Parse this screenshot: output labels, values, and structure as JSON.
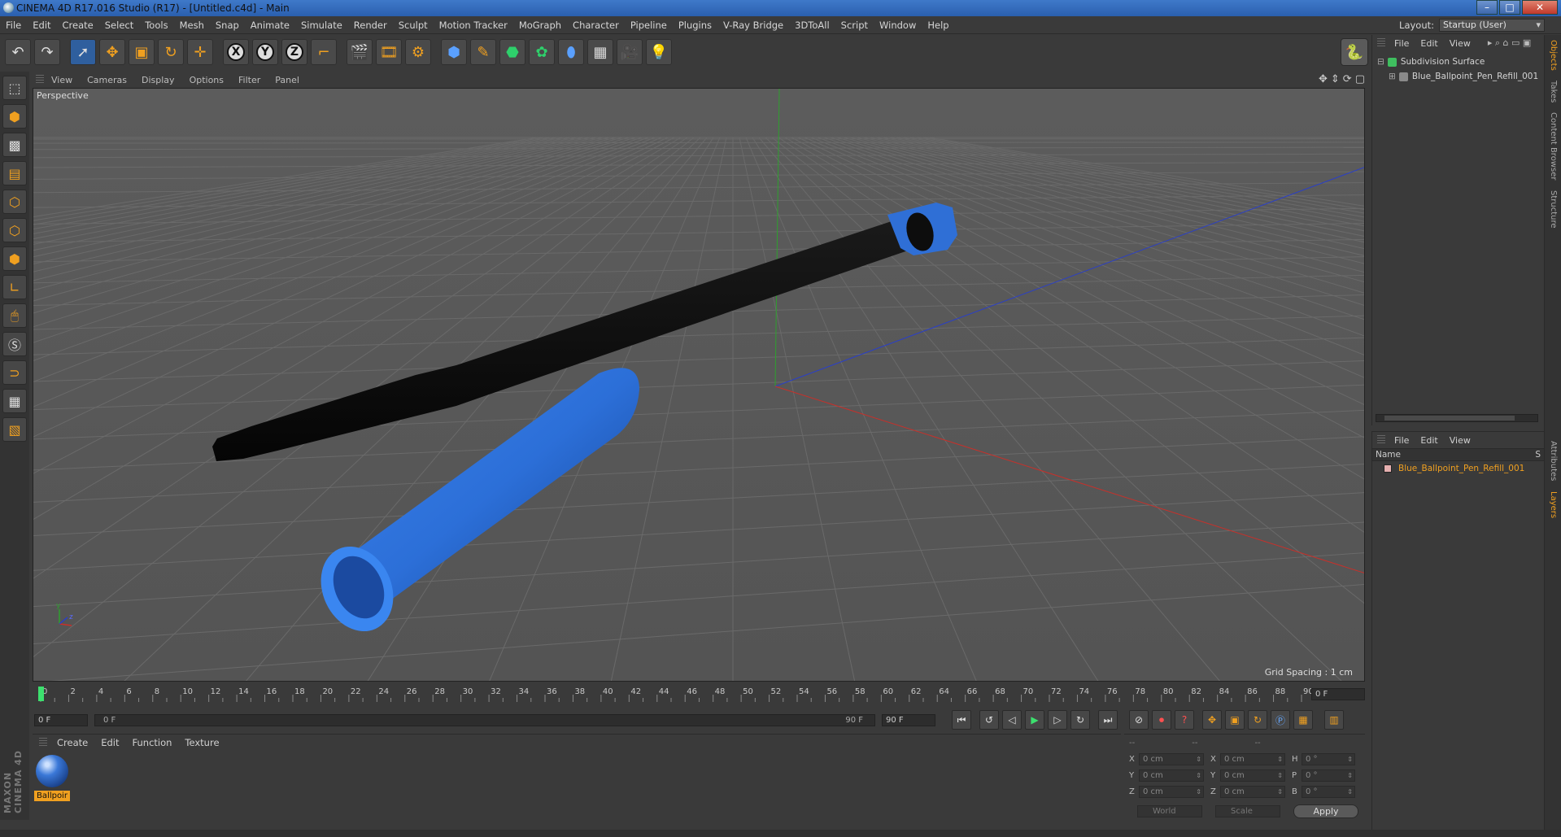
{
  "window": {
    "title": "CINEMA 4D R17.016 Studio (R17) - [Untitled.c4d] - Main",
    "min": "–",
    "max": "□",
    "close": "✕"
  },
  "menu": [
    "File",
    "Edit",
    "Create",
    "Select",
    "Tools",
    "Mesh",
    "Snap",
    "Animate",
    "Simulate",
    "Render",
    "Sculpt",
    "Motion Tracker",
    "MoGraph",
    "Character",
    "Pipeline",
    "Plugins",
    "V-Ray Bridge",
    "3DToAll",
    "Script",
    "Window",
    "Help"
  ],
  "layout": {
    "label": "Layout:",
    "value": "Startup (User)"
  },
  "toolbar": {
    "x_label": "X",
    "y_label": "Y",
    "z_label": "Z"
  },
  "viewport": {
    "menu": [
      "View",
      "Cameras",
      "Display",
      "Options",
      "Filter",
      "Panel"
    ],
    "camera": "Perspective",
    "grid_spacing": "Grid Spacing : 1 cm",
    "gizmo_y": "y",
    "gizmo_z": "z"
  },
  "timeline": {
    "ticks": [
      0,
      2,
      4,
      6,
      8,
      10,
      12,
      14,
      16,
      18,
      20,
      22,
      24,
      26,
      28,
      30,
      32,
      34,
      36,
      38,
      40,
      42,
      44,
      46,
      48,
      50,
      52,
      54,
      56,
      58,
      60,
      62,
      64,
      66,
      68,
      70,
      72,
      74,
      76,
      78,
      80,
      82,
      84,
      86,
      88,
      90
    ],
    "max_frame": 90,
    "current_frame_field": "0 F",
    "start_field": "0 F",
    "range_start": "0 F",
    "range_end": "90 F",
    "end_field": "90 F"
  },
  "material_manager": {
    "menu": [
      "Create",
      "Edit",
      "Function",
      "Texture"
    ],
    "material_name": "Ballpoir"
  },
  "coordinates": {
    "header": [
      "--",
      "--",
      "--"
    ],
    "rows": [
      {
        "a": "X",
        "av": "0 cm",
        "b": "X",
        "bv": "0 cm",
        "c": "H",
        "cv": "0 °"
      },
      {
        "a": "Y",
        "av": "0 cm",
        "b": "Y",
        "bv": "0 cm",
        "c": "P",
        "cv": "0 °"
      },
      {
        "a": "Z",
        "av": "0 cm",
        "b": "Z",
        "bv": "0 cm",
        "c": "B",
        "cv": "0 °"
      }
    ],
    "mode1": "World",
    "mode2": "Scale",
    "apply": "Apply"
  },
  "object_manager": {
    "menu": [
      "File",
      "Edit",
      "View"
    ],
    "objects": [
      {
        "name": "Subdivision Surface",
        "color": "#3fbf5f"
      },
      {
        "name": "Blue_Ballpoint_Pen_Refill_001",
        "color": "#8a8a8a"
      }
    ]
  },
  "layer_manager": {
    "menu": [
      "File",
      "Edit",
      "View"
    ],
    "col_name": "Name",
    "col_s": "S",
    "layers": [
      {
        "name": "Blue_Ballpoint_Pen_Refill_001",
        "color": "#e6b0b0"
      }
    ]
  },
  "side_tabs": [
    "Objects",
    "Takes",
    "Content Browser",
    "Structure",
    "Attributes",
    "Layers"
  ],
  "brand": "MAXON CINEMA 4D",
  "colors": {
    "accent": "#f0a020",
    "pen_blue": "#2f6fd6",
    "selection_blue": "#2f5f9e"
  }
}
